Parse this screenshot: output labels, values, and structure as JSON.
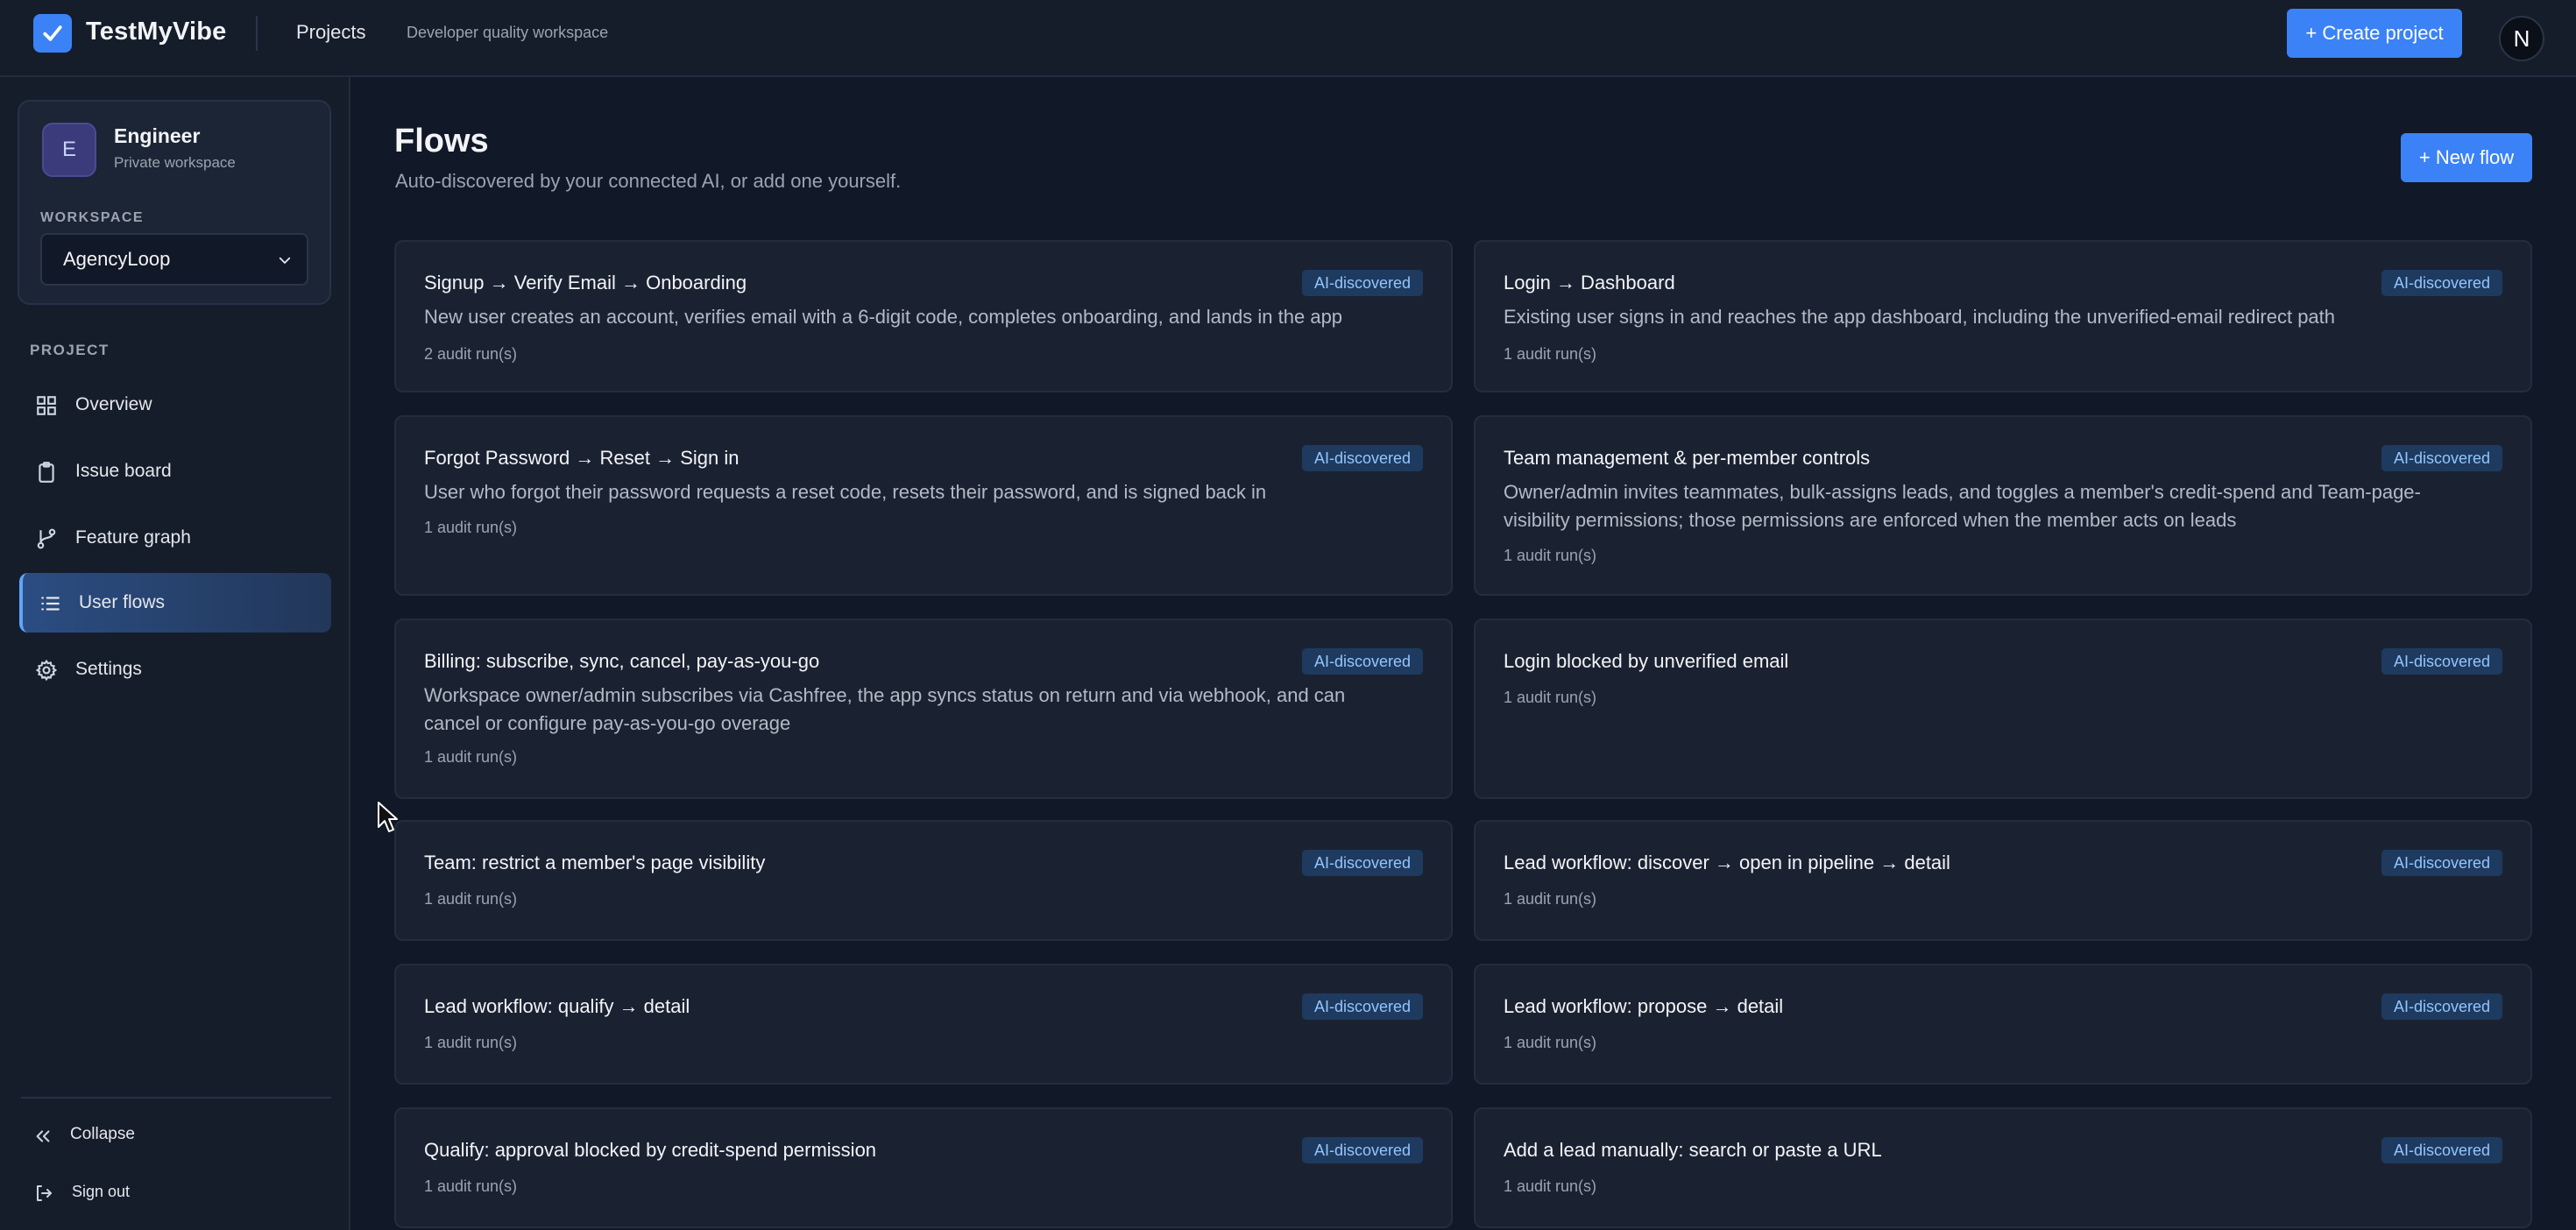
{
  "app": {
    "name": "TestMyVibe",
    "nav_projects": "Projects",
    "nav_subtitle": "Developer quality workspace",
    "create_project": "+ Create project",
    "user_initial": "N",
    "brand_color": "#3b82f6"
  },
  "workspace": {
    "initial": "E",
    "name": "Engineer",
    "type": "Private workspace",
    "label": "WORKSPACE",
    "selected": "AgencyLoop"
  },
  "sidebar": {
    "section_label": "PROJECT",
    "items": [
      {
        "label": "Overview",
        "icon": "grid-icon",
        "active": false
      },
      {
        "label": "Issue board",
        "icon": "clipboard-icon",
        "active": false
      },
      {
        "label": "Feature graph",
        "icon": "git-branch-icon",
        "active": false
      },
      {
        "label": "User flows",
        "icon": "list-icon",
        "active": true
      },
      {
        "label": "Settings",
        "icon": "gear-icon",
        "active": false
      }
    ],
    "collapse": "Collapse",
    "sign_out": "Sign out"
  },
  "main": {
    "title": "Flows",
    "subtitle": "Auto-discovered by your connected AI, or add one yourself.",
    "new_flow": "+ New flow"
  },
  "flows": [
    {
      "title": "Signup → Verify Email → Onboarding",
      "badge": "AI-discovered",
      "desc": "New user creates an account, verifies email with a 6-digit code, completes onboarding, and lands in the app",
      "runs": "2 audit run(s)"
    },
    {
      "title": "Login → Dashboard",
      "badge": "AI-discovered",
      "desc": "Existing user signs in and reaches the app dashboard, including the unverified-email redirect path",
      "runs": "1 audit run(s)"
    },
    {
      "title": "Forgot Password → Reset → Sign in",
      "badge": "AI-discovered",
      "desc": "User who forgot their password requests a reset code, resets their password, and is signed back in",
      "runs": "1 audit run(s)"
    },
    {
      "title": "Team management & per-member controls",
      "badge": "AI-discovered",
      "desc": "Owner/admin invites teammates, bulk-assigns leads, and toggles a member's credit-spend and Team-page-visibility permissions; those permissions are enforced when the member acts on leads",
      "runs": "1 audit run(s)"
    },
    {
      "title": "Billing: subscribe, sync, cancel, pay-as-you-go",
      "badge": "AI-discovered",
      "desc": "Workspace owner/admin subscribes via Cashfree, the app syncs status on return and via webhook, and can cancel or configure pay-as-you-go overage",
      "runs": "1 audit run(s)"
    },
    {
      "title": "Login blocked by unverified email",
      "badge": "AI-discovered",
      "desc": "",
      "runs": "1 audit run(s)"
    },
    {
      "title": "Team: restrict a member's page visibility",
      "badge": "AI-discovered",
      "desc": "",
      "runs": "1 audit run(s)"
    },
    {
      "title": "Lead workflow: discover → open in pipeline → detail",
      "badge": "AI-discovered",
      "desc": "",
      "runs": "1 audit run(s)"
    },
    {
      "title": "Lead workflow: qualify → detail",
      "badge": "AI-discovered",
      "desc": "",
      "runs": "1 audit run(s)"
    },
    {
      "title": "Lead workflow: propose → detail",
      "badge": "AI-discovered",
      "desc": "",
      "runs": "1 audit run(s)"
    },
    {
      "title": "Qualify: approval blocked by credit-spend permission",
      "badge": "AI-discovered",
      "desc": "",
      "runs": "1 audit run(s)"
    },
    {
      "title": "Add a lead manually: search or paste a URL",
      "badge": "AI-discovered",
      "desc": "",
      "runs": "1 audit run(s)"
    }
  ]
}
